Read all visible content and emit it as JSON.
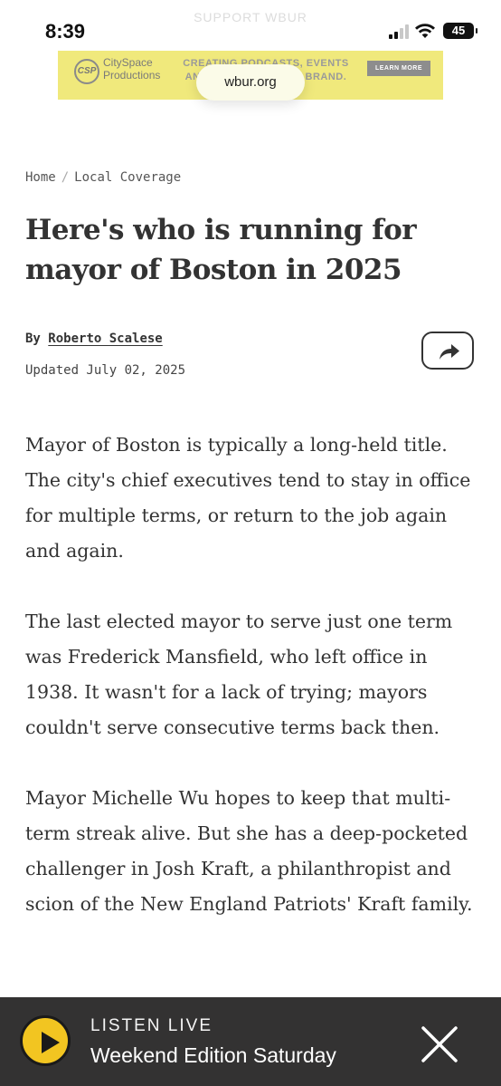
{
  "status_bar": {
    "time": "8:39",
    "battery": "45",
    "overlay_text": "SUPPORT WBUR"
  },
  "ad": {
    "logo_text": "CSP",
    "brand": "CitySpace Productions",
    "tagline": "CREATING PODCASTS, EVENTS AND MORE FOR YOUR BRAND.",
    "cta": "LEARN MORE",
    "background": "#f0e97c"
  },
  "browser": {
    "url": "wbur.org"
  },
  "breadcrumb": {
    "home": "Home",
    "separator": "/",
    "section": "Local Coverage"
  },
  "article": {
    "title": "Here's who is running for mayor of Boston in 2025",
    "by_prefix": "By",
    "author": "Roberto Scalese",
    "updated": "Updated July 02, 2025",
    "share_icon": "share-arrow-icon",
    "paragraphs": [
      "Mayor of Boston is typically a long-held title. The city's chief executives tend to stay in office for multiple terms, or return to the job again and again.",
      "The last elected mayor to serve just one term was Frederick Mansfield, who left office in 1938. It wasn't for a lack of trying; mayors couldn't serve consecutive terms back then.",
      "Mayor Michelle Wu hopes to keep that multi-term streak alive. But she has a deep-pocketed challenger in Josh Kraft, a philanthropist and scion of the New England Patriots' Kraft family."
    ]
  },
  "player": {
    "label": "LISTEN LIVE",
    "program": "Weekend Edition Saturday",
    "play_color": "#f2c521",
    "background": "#333232"
  }
}
